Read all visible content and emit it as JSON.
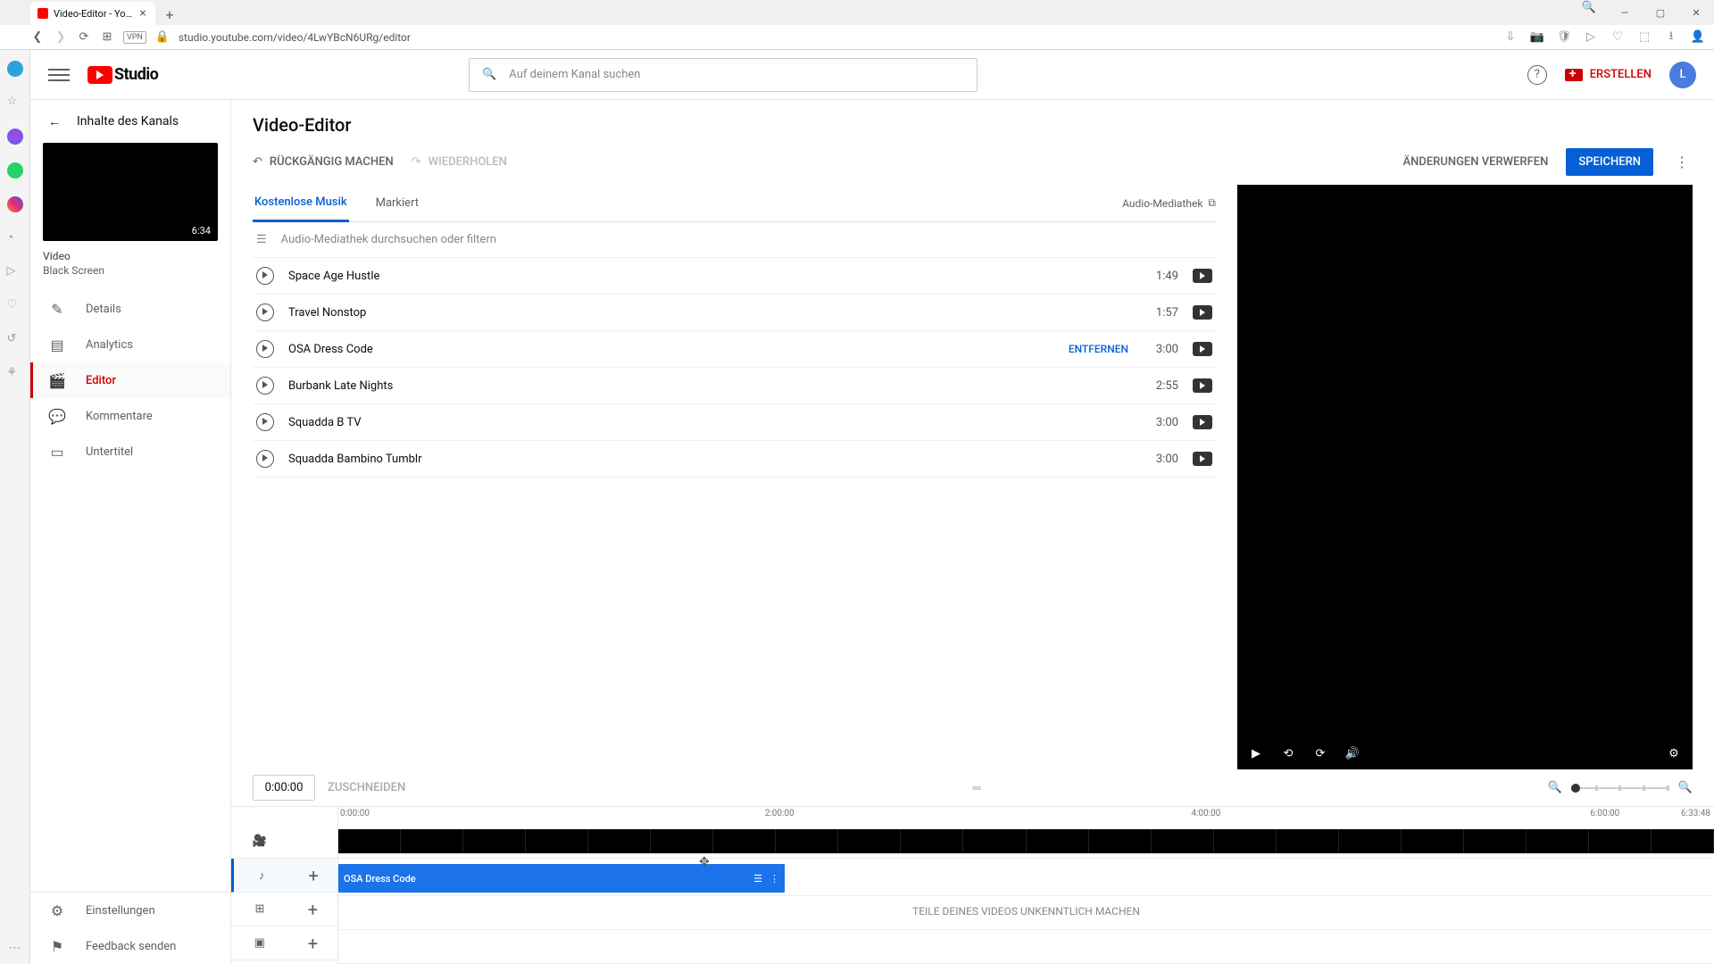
{
  "browser": {
    "tab_title": "Video-Editor - YouTube St…",
    "url": "studio.youtube.com/video/4LwYBcN6URg/editor",
    "vpn_label": "VPN",
    "search_icon": "🔍"
  },
  "topbar": {
    "logo_text": "Studio",
    "search_placeholder": "Auf deinem Kanal suchen",
    "create_label": "ERSTELLEN",
    "avatar_letter": "L"
  },
  "leftrail": {
    "back_label": "Inhalte des Kanals",
    "thumb_duration": "6:34",
    "video_label": "Video",
    "video_name": "Black Screen",
    "items": [
      {
        "label": "Details",
        "icon": "✎"
      },
      {
        "label": "Analytics",
        "icon": "▤"
      },
      {
        "label": "Editor",
        "icon": "🎬"
      },
      {
        "label": "Kommentare",
        "icon": "💬"
      },
      {
        "label": "Untertitel",
        "icon": "▭"
      }
    ],
    "bottom": [
      {
        "label": "Einstellungen",
        "icon": "⚙"
      },
      {
        "label": "Feedback senden",
        "icon": "⚑"
      }
    ]
  },
  "editor": {
    "title": "Video-Editor",
    "undo": "RÜCKGÄNGIG MACHEN",
    "redo": "WIEDERHOLEN",
    "discard": "ÄNDERUNGEN VERWERFEN",
    "save": "SPEICHERN"
  },
  "music": {
    "tab_free": "Kostenlose Musik",
    "tab_marked": "Markiert",
    "library_link": "Audio-Mediathek",
    "filter_placeholder": "Audio-Mediathek durchsuchen oder filtern",
    "remove_label": "ENTFERNEN",
    "tracks": [
      {
        "name": "Space Age Hustle",
        "dur": "1:49"
      },
      {
        "name": "Travel Nonstop",
        "dur": "1:57"
      },
      {
        "name": "OSA Dress Code",
        "dur": "3:00",
        "selected": true
      },
      {
        "name": "Burbank Late Nights",
        "dur": "2:55"
      },
      {
        "name": "Squadda B TV",
        "dur": "3:00"
      },
      {
        "name": "Squadda Bambino Tumblr",
        "dur": "3:00"
      }
    ]
  },
  "timeline": {
    "current_time": "0:00:00",
    "trim_label": "ZUSCHNEIDEN",
    "ruler": {
      "t0": "0:00:00",
      "t2": "2:00:00",
      "t4": "4:00:00",
      "t6": "6:00:00",
      "end": "6:33:48"
    },
    "audio_clip_name": "OSA Dress Code",
    "blur_hint": "TEILE DEINES VIDEOS UNKENNTLICH MACHEN"
  }
}
